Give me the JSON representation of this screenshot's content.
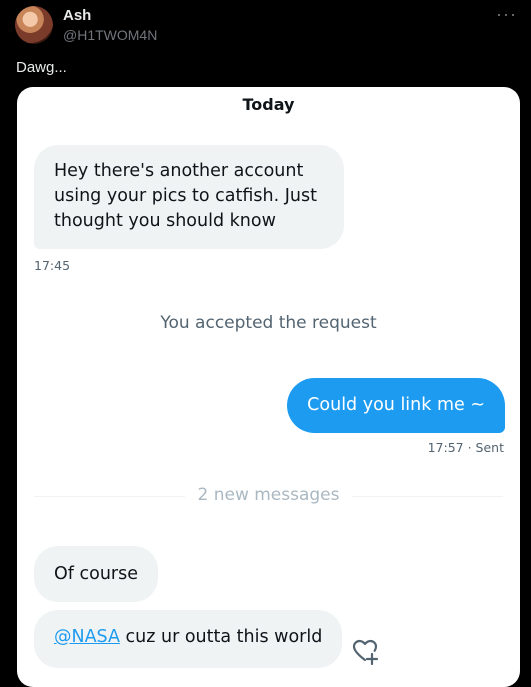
{
  "tweet": {
    "author_name": "Ash",
    "author_handle": "@H1TWOM4N",
    "more_label": "···",
    "text": "Dawg..."
  },
  "dm": {
    "date_header": "Today",
    "messages": [
      {
        "direction": "received",
        "text": "Hey there's another account using your pics to catfish. Just thought you should know",
        "time": "17:45"
      },
      {
        "direction": "sent",
        "text": "Could you link me ~",
        "time": "17:57",
        "status": "· Sent"
      }
    ],
    "system_notice": "You accepted the request",
    "new_messages_label": "2 new messages",
    "new_messages": [
      {
        "text": "Of course"
      },
      {
        "mention": "@NASA",
        "text": " cuz ur outta this world"
      }
    ]
  },
  "colors": {
    "accent": "#1d9bf0",
    "bubble_in": "#eff3f4",
    "background": "#000000"
  },
  "icons": {
    "react": "add-reaction-heart-icon"
  }
}
